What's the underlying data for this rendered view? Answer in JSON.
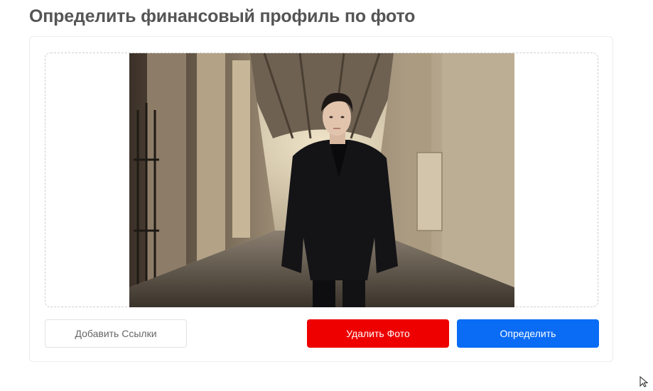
{
  "page": {
    "title": "Определить финансовый профиль по фото"
  },
  "upload": {
    "photo_alt": "Загруженное фото"
  },
  "actions": {
    "add_links_label": "Добавить Ссылки",
    "delete_photo_label": "Удалить Фото",
    "detect_label": "Определить"
  },
  "colors": {
    "delete": "#ee0000",
    "detect": "#0a6cf5",
    "title": "#555555"
  },
  "icons": {
    "cursor": "mouse-pointer-icon"
  }
}
